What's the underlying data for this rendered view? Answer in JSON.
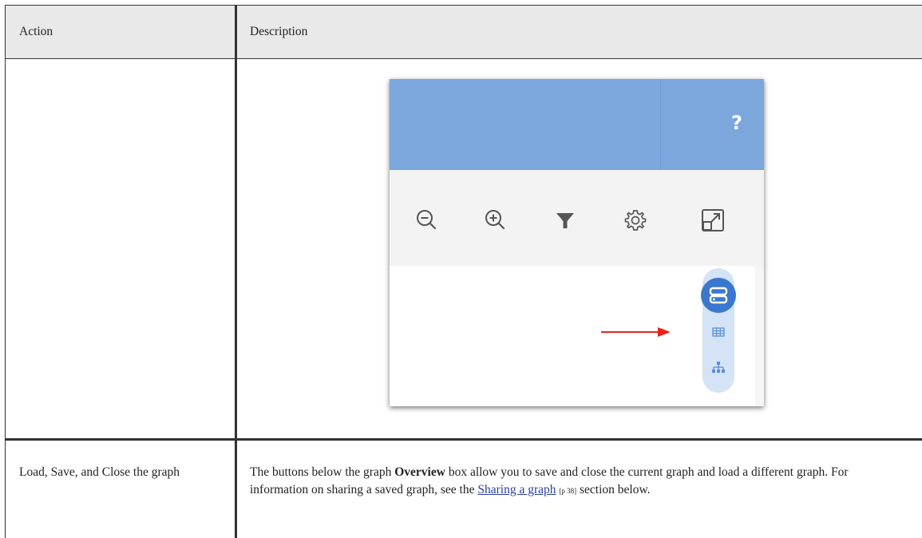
{
  "table": {
    "headers": [
      "Action",
      "Description"
    ],
    "rows": [
      {
        "action": "",
        "description_image": {
          "header_icon": "?",
          "toolbar_icons": [
            "zoom-out-icon",
            "zoom-in-icon",
            "filter-icon",
            "settings-icon",
            "expand-icon"
          ],
          "side_buttons": [
            "server-view-icon",
            "table-view-icon",
            "hierarchy-view-icon"
          ],
          "colors": {
            "header": "#7ba7dd",
            "accent": "#3a78cf",
            "arrow": "#e8231c"
          }
        }
      },
      {
        "action": "Load, Save, and Close the graph",
        "description": {
          "text_before": "The buttons below the graph ",
          "bold": "Overview",
          "text_middle": " box allow you to save and close the current graph and load a different graph. For information on sharing a saved graph, see the ",
          "link": "Sharing a graph",
          "link_ref": "[p 38]",
          "text_after": " section below."
        }
      }
    ]
  }
}
